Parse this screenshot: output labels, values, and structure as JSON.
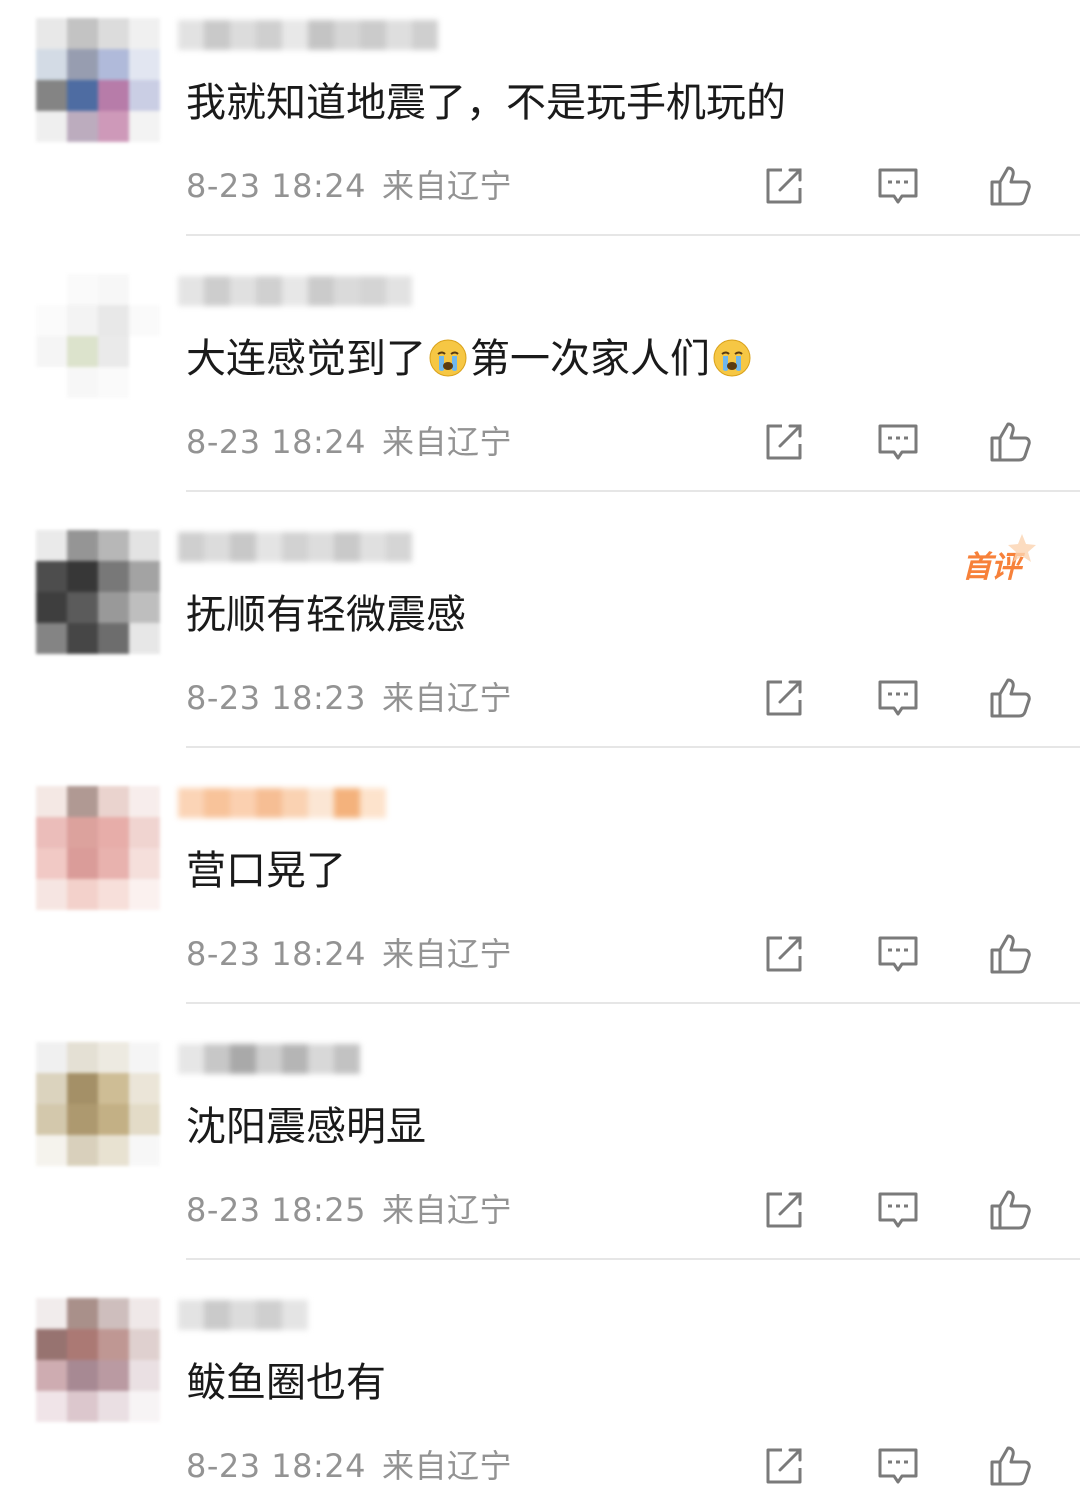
{
  "comments": [
    {
      "text": "我就知道地震了，不是玩手机玩的",
      "time": "8-23 18:24",
      "location": "来自辽宁"
    },
    {
      "text_a": "大连感觉到了",
      "text_b": "第一次家人们",
      "emoji": "crying-face-icon",
      "time": "8-23 18:24",
      "location": "来自辽宁"
    },
    {
      "text": "抚顺有轻微震感",
      "time": "8-23 18:23",
      "location": "来自辽宁",
      "badge": "首评"
    },
    {
      "text": "营口晃了",
      "time": "8-23 18:24",
      "location": "来自辽宁"
    },
    {
      "text": "沈阳震感明显",
      "time": "8-23 18:25",
      "location": "来自辽宁"
    },
    {
      "text": "鲅鱼圈也有",
      "time": "8-23 18:24",
      "location": "来自辽宁"
    }
  ],
  "icons": {
    "share": "share-icon",
    "reply": "comment-icon",
    "like": "thumbs-up-icon"
  },
  "colors": {
    "text": "#1a1a1a",
    "meta": "#939393",
    "icon": "#7a7a7a",
    "divider": "#e6e6e6",
    "badge": "#f7813a"
  }
}
